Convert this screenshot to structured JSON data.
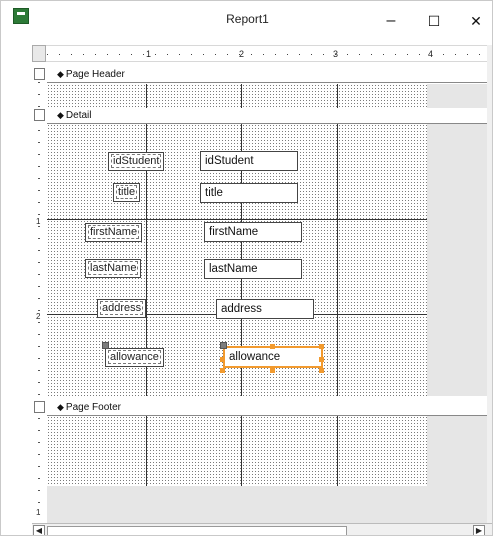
{
  "window": {
    "title": "Report1",
    "minimize_glyph": "–",
    "maximize_glyph": "☐",
    "close_glyph": "✕"
  },
  "ruler": {
    "marks": [
      "1",
      "2",
      "3",
      "4"
    ]
  },
  "vertical_ruler": {
    "marks": [
      "1",
      "2",
      "1"
    ]
  },
  "sections": {
    "page_header": "Page Header",
    "detail": "Detail",
    "page_footer": "Page Footer"
  },
  "labels": {
    "idStudent": "idStudent",
    "title": "title",
    "firstName": "firstName",
    "lastName": "lastName",
    "address": "address",
    "allowance": "allowance"
  },
  "fields": {
    "idStudent": "idStudent",
    "title": "title",
    "firstName": "firstName",
    "lastName": "lastName",
    "address": "address",
    "allowance": "allowance"
  },
  "scrollbar": {
    "left_glyph": "◀",
    "right_glyph": "▶"
  },
  "colors": {
    "selection": "#f29a2e",
    "app_icon": "#2d7a37"
  }
}
